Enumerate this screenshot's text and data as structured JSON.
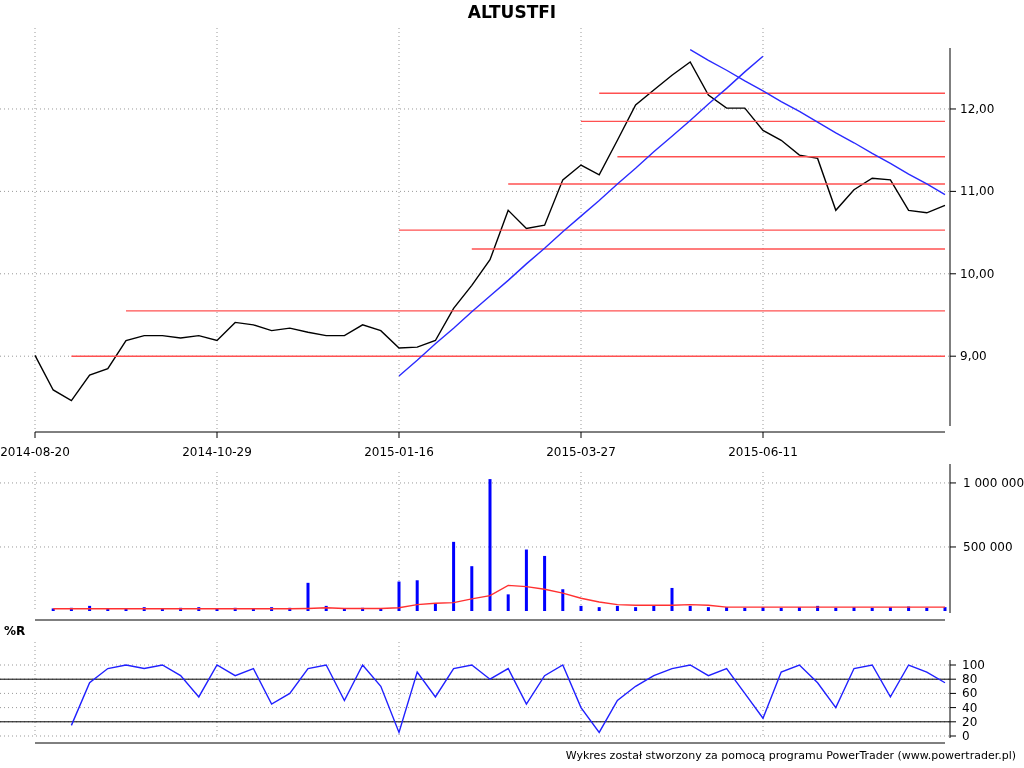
{
  "title": "ALTUSTFI",
  "price_chart": {
    "chart_data": {
      "type": "line",
      "grid": true,
      "ylim": [
        8.08,
        12.74
      ],
      "yticks": [
        {
          "value": 9,
          "label": "9,00"
        },
        {
          "value": 10,
          "label": "10,00"
        },
        {
          "value": 11,
          "label": "11,00"
        },
        {
          "value": 12,
          "label": "12,00"
        }
      ],
      "categories": [
        "2014-08-20",
        null,
        null,
        null,
        null,
        null,
        null,
        null,
        null,
        null,
        "2014-10-29",
        null,
        null,
        null,
        null,
        null,
        null,
        null,
        null,
        null,
        "2015-01-16",
        null,
        null,
        null,
        null,
        null,
        null,
        null,
        null,
        null,
        "2015-03-27",
        null,
        null,
        null,
        null,
        null,
        null,
        null,
        null,
        null,
        "2015-06-11",
        null,
        null,
        null,
        null,
        null,
        null,
        null,
        null,
        null,
        null
      ],
      "series": [
        {
          "color": "#000000",
          "values": [
            9.01,
            8.59,
            8.46,
            8.77,
            8.85,
            9.19,
            9.25,
            9.25,
            9.22,
            9.25,
            9.19,
            9.41,
            9.38,
            9.31,
            9.34,
            9.29,
            9.25,
            9.25,
            9.38,
            9.31,
            9.1,
            9.11,
            9.19,
            9.58,
            9.86,
            10.17,
            10.77,
            10.55,
            10.59,
            11.14,
            11.32,
            11.2,
            11.62,
            12.05,
            12.23,
            12.41,
            12.57,
            12.17,
            12.01,
            12.01,
            11.74,
            11.62,
            11.44,
            11.4,
            10.77,
            11.02,
            11.16,
            11.14,
            10.77,
            10.74,
            10.83
          ]
        },
        {
          "color": "#ff5050",
          "values": [
            null,
            null,
            9,
            9,
            9,
            9,
            9,
            9,
            9,
            9,
            9,
            9,
            9,
            9,
            9,
            9,
            9,
            9,
            9,
            9,
            9,
            9,
            9,
            9,
            9,
            9,
            9,
            9,
            9,
            9,
            9,
            9,
            9,
            9,
            9,
            9,
            9,
            9,
            9,
            9,
            9,
            9,
            9,
            9,
            9,
            9,
            9,
            9,
            9,
            9,
            9
          ]
        },
        {
          "color": "#ff5050",
          "values": [
            null,
            null,
            null,
            null,
            null,
            9.55,
            9.55,
            9.55,
            9.55,
            9.55,
            9.55,
            9.55,
            9.55,
            9.55,
            9.55,
            9.55,
            9.55,
            9.55,
            9.55,
            9.55,
            9.55,
            9.55,
            9.55,
            9.55,
            9.55,
            9.55,
            9.55,
            9.55,
            9.55,
            9.55,
            9.55,
            9.55,
            9.55,
            9.55,
            9.55,
            9.55,
            9.55,
            9.55,
            9.55,
            9.55,
            9.55,
            9.55,
            9.55,
            9.55,
            9.55,
            9.55,
            9.55,
            9.55,
            9.55,
            9.55,
            9.55
          ]
        },
        {
          "color": "#ff5050",
          "values": [
            null,
            null,
            null,
            null,
            null,
            null,
            null,
            null,
            null,
            null,
            null,
            null,
            null,
            null,
            null,
            null,
            null,
            null,
            null,
            null,
            null,
            null,
            null,
            null,
            10.3,
            10.3,
            10.3,
            10.3,
            10.3,
            10.3,
            10.3,
            10.3,
            10.3,
            10.3,
            10.3,
            10.3,
            10.3,
            10.3,
            10.3,
            10.3,
            10.3,
            10.3,
            10.3,
            10.3,
            10.3,
            10.3,
            10.3,
            10.3,
            10.3,
            10.3,
            10.3
          ]
        },
        {
          "color": "#ff5050",
          "values": [
            null,
            null,
            null,
            null,
            null,
            null,
            null,
            null,
            null,
            null,
            null,
            null,
            null,
            null,
            null,
            null,
            null,
            null,
            null,
            null,
            10.53,
            10.53,
            10.53,
            10.53,
            10.53,
            10.53,
            10.53,
            10.53,
            10.53,
            10.53,
            10.53,
            10.53,
            10.53,
            10.53,
            10.53,
            10.53,
            10.53,
            10.53,
            10.53,
            10.53,
            10.53,
            10.53,
            10.53,
            10.53,
            10.53,
            10.53,
            10.53,
            10.53,
            10.53,
            10.53,
            10.53
          ]
        },
        {
          "color": "#ff5050",
          "values": [
            null,
            null,
            null,
            null,
            null,
            null,
            null,
            null,
            null,
            null,
            null,
            null,
            null,
            null,
            null,
            null,
            null,
            null,
            null,
            null,
            null,
            null,
            null,
            null,
            null,
            null,
            11.09,
            11.09,
            11.09,
            11.09,
            11.09,
            11.09,
            11.09,
            11.09,
            11.09,
            11.09,
            11.09,
            11.09,
            11.09,
            11.09,
            11.09,
            11.09,
            11.09,
            11.09,
            11.09,
            11.09,
            11.09,
            11.09,
            11.09,
            11.09,
            11.09
          ]
        },
        {
          "color": "#ff5050",
          "values": [
            null,
            null,
            null,
            null,
            null,
            null,
            null,
            null,
            null,
            null,
            null,
            null,
            null,
            null,
            null,
            null,
            null,
            null,
            null,
            null,
            null,
            null,
            null,
            null,
            null,
            null,
            null,
            null,
            null,
            null,
            null,
            null,
            11.42,
            11.42,
            11.42,
            11.42,
            11.42,
            11.42,
            11.42,
            11.42,
            11.42,
            11.42,
            11.42,
            11.42,
            11.42,
            11.42,
            11.42,
            11.42,
            11.42,
            11.42,
            11.42
          ]
        },
        {
          "color": "#ff5050",
          "values": [
            null,
            null,
            null,
            null,
            null,
            null,
            null,
            null,
            null,
            null,
            null,
            null,
            null,
            null,
            null,
            null,
            null,
            null,
            null,
            null,
            null,
            null,
            null,
            null,
            null,
            null,
            null,
            null,
            null,
            null,
            11.85,
            11.85,
            11.85,
            11.85,
            11.85,
            11.85,
            11.85,
            11.85,
            11.85,
            11.85,
            11.85,
            11.85,
            11.85,
            11.85,
            11.85,
            11.85,
            11.85,
            11.85,
            11.85,
            11.85,
            11.85
          ]
        },
        {
          "color": "#ff5050",
          "values": [
            null,
            null,
            null,
            null,
            null,
            null,
            null,
            null,
            null,
            null,
            null,
            null,
            null,
            null,
            null,
            null,
            null,
            null,
            null,
            null,
            null,
            null,
            null,
            null,
            null,
            null,
            null,
            null,
            null,
            null,
            null,
            12.19,
            12.19,
            12.19,
            12.19,
            12.19,
            12.19,
            12.19,
            12.19,
            12.19,
            12.19,
            12.19,
            12.19,
            12.19,
            12.19,
            12.19,
            12.19,
            12.19,
            12.19,
            12.19,
            12.19
          ]
        },
        {
          "color": "#2a2aff",
          "values": [
            null,
            null,
            null,
            null,
            null,
            null,
            null,
            null,
            null,
            null,
            null,
            null,
            null,
            null,
            null,
            null,
            null,
            null,
            null,
            null,
            8.76,
            8.95,
            9.15,
            9.34,
            9.54,
            9.73,
            9.92,
            10.12,
            10.31,
            10.51,
            10.7,
            10.89,
            11.09,
            11.28,
            11.48,
            11.67,
            11.86,
            12.06,
            12.25,
            12.45,
            12.64,
            null,
            null,
            null,
            null,
            null,
            null,
            null,
            null,
            null,
            null
          ]
        },
        {
          "color": "#2a2aff",
          "values": [
            null,
            null,
            null,
            null,
            null,
            null,
            null,
            null,
            null,
            null,
            null,
            null,
            null,
            null,
            null,
            null,
            null,
            null,
            null,
            null,
            null,
            null,
            null,
            null,
            null,
            null,
            null,
            null,
            null,
            null,
            null,
            null,
            null,
            null,
            null,
            null,
            12.72,
            12.59,
            12.47,
            12.34,
            12.22,
            12.09,
            11.97,
            11.84,
            11.71,
            11.59,
            11.46,
            11.34,
            11.21,
            11.09,
            10.96
          ]
        }
      ]
    }
  },
  "volume_chart": {
    "chart_data": {
      "type": "bar",
      "grid": true,
      "ylim": [
        0,
        1148000
      ],
      "yticks": [
        {
          "value": 500000,
          "label": "500 000"
        },
        {
          "value": 1000000,
          "label": "1 000 000"
        }
      ],
      "categories": [
        null,
        null,
        null,
        null,
        null,
        null,
        null,
        null,
        null,
        null,
        null,
        null,
        null,
        null,
        null,
        null,
        null,
        null,
        null,
        null,
        null,
        null,
        null,
        null,
        null,
        null,
        null,
        null,
        null,
        null,
        null,
        null,
        null,
        null,
        null,
        null,
        null,
        null,
        null,
        null,
        null,
        null,
        null,
        null,
        null,
        null,
        null,
        null,
        null,
        null,
        null
      ],
      "series": [
        {
          "color": "#0000ff",
          "values": [
            null,
            20000,
            25000,
            40000,
            20000,
            20000,
            30000,
            20000,
            25000,
            30000,
            20000,
            25000,
            20000,
            30000,
            25000,
            220000,
            40000,
            20000,
            25000,
            20000,
            230000,
            240000,
            60000,
            540000,
            350000,
            1030000,
            130000,
            480000,
            430000,
            170000,
            40000,
            30000,
            40000,
            30000,
            40000,
            180000,
            40000,
            30000,
            30000,
            25000,
            30000,
            25000,
            30000,
            40000,
            25000,
            30000,
            25000,
            30000,
            35000,
            25000,
            30000
          ]
        },
        {
          "type": "line",
          "color": "#ff3030",
          "values": [
            null,
            18000,
            18000,
            18000,
            18000,
            18000,
            18000,
            18000,
            18000,
            18000,
            18000,
            18000,
            18000,
            18000,
            18000,
            20000,
            25000,
            20000,
            20000,
            20000,
            25000,
            50000,
            60000,
            65000,
            95000,
            120000,
            200000,
            190000,
            170000,
            140000,
            100000,
            70000,
            50000,
            45000,
            45000,
            45000,
            50000,
            45000,
            30000,
            30000,
            30000,
            30000,
            30000,
            30000,
            30000,
            30000,
            30000,
            30000,
            30000,
            30000,
            30000
          ]
        }
      ]
    }
  },
  "williams_chart": {
    "label": "%R",
    "chart_data": {
      "type": "line",
      "grid": true,
      "ylim": [
        0,
        100
      ],
      "yticks": [
        0,
        20,
        40,
        60,
        80,
        100
      ],
      "categories": [
        null,
        null,
        null,
        null,
        null,
        null,
        null,
        null,
        null,
        null,
        null,
        null,
        null,
        null,
        null,
        null,
        null,
        null,
        null,
        null,
        null,
        null,
        null,
        null,
        null,
        null,
        null,
        null,
        null,
        null,
        null,
        null,
        null,
        null,
        null,
        null,
        null,
        null,
        null,
        null,
        null,
        null,
        null,
        null,
        null,
        null,
        null,
        null,
        null,
        null,
        null
      ],
      "series": [
        {
          "color": "#2020ff",
          "values": [
            null,
            null,
            15,
            75,
            95,
            100,
            95,
            100,
            85,
            55,
            100,
            85,
            95,
            45,
            60,
            95,
            100,
            50,
            100,
            70,
            5,
            90,
            55,
            95,
            100,
            80,
            95,
            45,
            85,
            100,
            40,
            5,
            50,
            70,
            85,
            95,
            100,
            85,
            95,
            60,
            25,
            90,
            100,
            75,
            40,
            95,
            100,
            55,
            100,
            90,
            75
          ]
        }
      ]
    }
  },
  "footer": "Wykres został stworzony za pomocą programu PowerTrader (www.powertrader.pl)"
}
